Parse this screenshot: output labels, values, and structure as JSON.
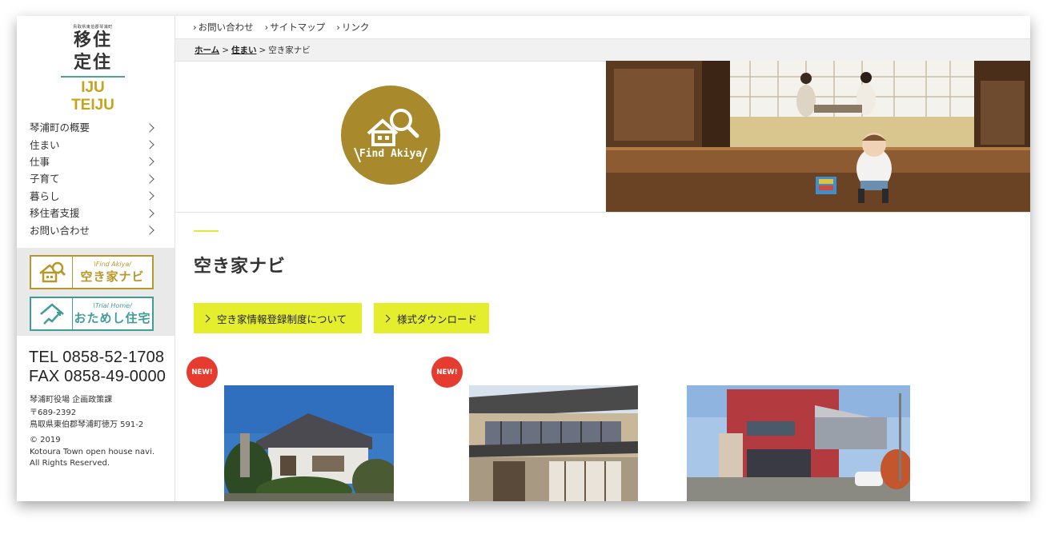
{
  "logo": {
    "small": "鳥取県東伯郡琴浦町",
    "line1": "移住",
    "line2": "定住",
    "en": "IJU TEIJU"
  },
  "nav": [
    {
      "label": "琴浦町の概要"
    },
    {
      "label": "住まい"
    },
    {
      "label": "仕事"
    },
    {
      "label": "子育て"
    },
    {
      "label": "暮らし"
    },
    {
      "label": "移住者支援"
    },
    {
      "label": "お問い合わせ"
    }
  ],
  "banners": {
    "akiya": {
      "sub": "\\Find Akiya/",
      "main": "空き家ナビ"
    },
    "trial": {
      "sub": "\\Trial Home/",
      "main": "おためし住宅"
    }
  },
  "contact": {
    "tel": "TEL 0858-52-1708",
    "fax": "FAX 0858-49-0000",
    "office": "琴浦町役場 企画政策課",
    "zip": "〒689-2392",
    "address": "鳥取県東伯郡琴浦町徳万 591-2",
    "copy1": "© 2019",
    "copy2": "Kotoura Town open house navi.",
    "copy3": "All Rights Reserved."
  },
  "topnav": [
    "お問い合わせ",
    "サイトマップ",
    "リンク"
  ],
  "breadcrumb": {
    "home": "ホーム",
    "sep": ">",
    "living": "住まい",
    "current": "空き家ナビ"
  },
  "hero": {
    "circle_text": "Find Akiya"
  },
  "page": {
    "title": "空き家ナビ",
    "btn_register": "空き家情報登録制度について",
    "btn_download": "様式ダウンロード"
  },
  "cards": [
    {
      "badge": "NEW!"
    },
    {
      "badge": "NEW!"
    },
    {
      "badge": ""
    }
  ],
  "colors": {
    "gold": "#b8982a",
    "teal": "#3f9d98",
    "yellow_button": "#e4ee2d",
    "new_badge": "#e53c2f"
  }
}
